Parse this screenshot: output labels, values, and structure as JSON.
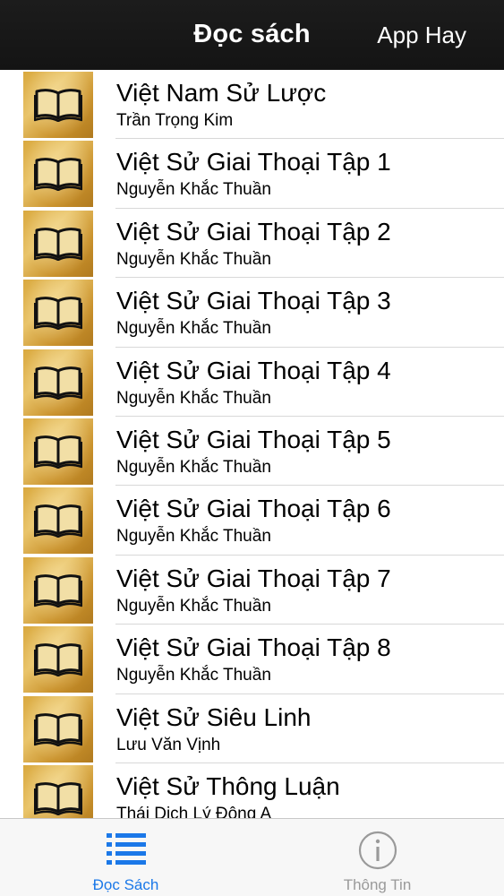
{
  "navbar": {
    "title": "Đọc sách",
    "right_button": "App Hay"
  },
  "books": [
    {
      "title": "Việt Nam Sử Lược",
      "author": "Trần Trọng Kim"
    },
    {
      "title": "Việt Sử Giai Thoại Tập 1",
      "author": "Nguyễn Khắc Thuần"
    },
    {
      "title": "Việt Sử Giai Thoại Tập 2",
      "author": "Nguyễn Khắc Thuần"
    },
    {
      "title": "Việt Sử Giai Thoại Tập 3",
      "author": "Nguyễn Khắc Thuần"
    },
    {
      "title": "Việt Sử Giai Thoại Tập 4",
      "author": "Nguyễn Khắc Thuần"
    },
    {
      "title": "Việt Sử Giai Thoại Tập 5",
      "author": "Nguyễn Khắc Thuần"
    },
    {
      "title": "Việt Sử Giai Thoại Tập 6",
      "author": "Nguyễn Khắc Thuần"
    },
    {
      "title": "Việt Sử Giai Thoại Tập 7",
      "author": "Nguyễn Khắc Thuần"
    },
    {
      "title": "Việt Sử Giai Thoại Tập 8",
      "author": "Nguyễn Khắc Thuần"
    },
    {
      "title": "Việt Sử Siêu Linh",
      "author": "Lưu Văn Vịnh"
    },
    {
      "title": "Việt Sử Thông Luận",
      "author": "Thái Dịch Lý Đông A"
    }
  ],
  "tabbar": {
    "tabs": [
      {
        "label": "Đọc Sách",
        "icon": "list-icon",
        "active": true
      },
      {
        "label": "Thông Tin",
        "icon": "info-icon",
        "active": false
      }
    ]
  },
  "colors": {
    "active_tab": "#1b78e8",
    "inactive_tab": "#9a9a9a",
    "navbar_bg": "#161616"
  }
}
